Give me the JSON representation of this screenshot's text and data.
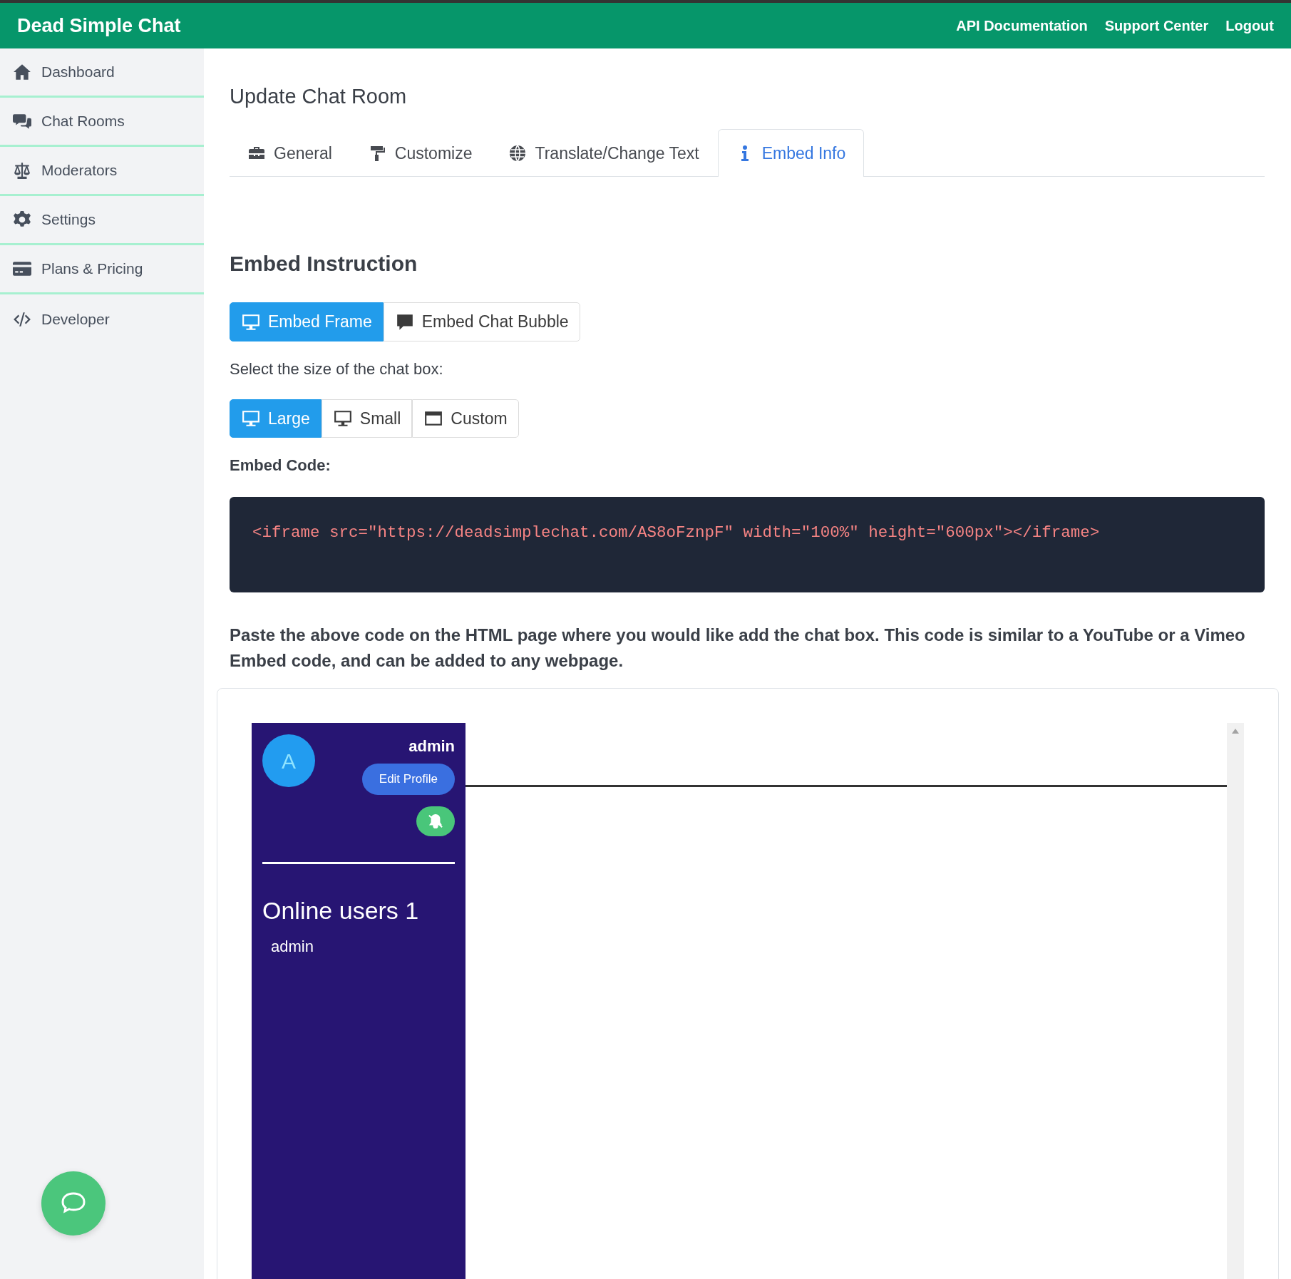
{
  "navbar": {
    "brand": "Dead Simple Chat",
    "links": [
      "API Documentation",
      "Support Center",
      "Logout"
    ]
  },
  "sidebar": {
    "items": [
      {
        "label": "Dashboard"
      },
      {
        "label": "Chat Rooms"
      },
      {
        "label": "Moderators"
      },
      {
        "label": "Settings"
      },
      {
        "label": "Plans & Pricing"
      },
      {
        "label": "Developer"
      }
    ]
  },
  "page_title": "Update Chat Room",
  "tabs": [
    {
      "label": "General",
      "selected": false
    },
    {
      "label": "Customize",
      "selected": false
    },
    {
      "label": "Translate/Change Text",
      "selected": false
    },
    {
      "label": "Embed Info",
      "selected": true
    }
  ],
  "section_title": "Embed Instruction",
  "embed_types": [
    {
      "label": "Embed Frame",
      "selected": true
    },
    {
      "label": "Embed Chat Bubble",
      "selected": false
    }
  ],
  "size_prompt": "Select the size of the chat box:",
  "sizes": [
    {
      "label": "Large",
      "selected": true
    },
    {
      "label": "Small",
      "selected": false
    },
    {
      "label": "Custom",
      "selected": false
    }
  ],
  "embed_code_label": "Embed Code:",
  "embed_code": "<iframe src=\"https://deadsimplechat.com/AS8oFznpF\" width=\"100%\" height=\"600px\"></iframe>",
  "instructions": "Paste the above code on the HTML page where you would like add the chat box. This code is similar to a YouTube or a Vimeo Embed code, and can be added to any webpage.",
  "preview": {
    "avatar_initial": "A",
    "username": "admin",
    "edit_button": "Edit Profile",
    "online_title": "Online users 1",
    "online_users": [
      "admin"
    ]
  }
}
